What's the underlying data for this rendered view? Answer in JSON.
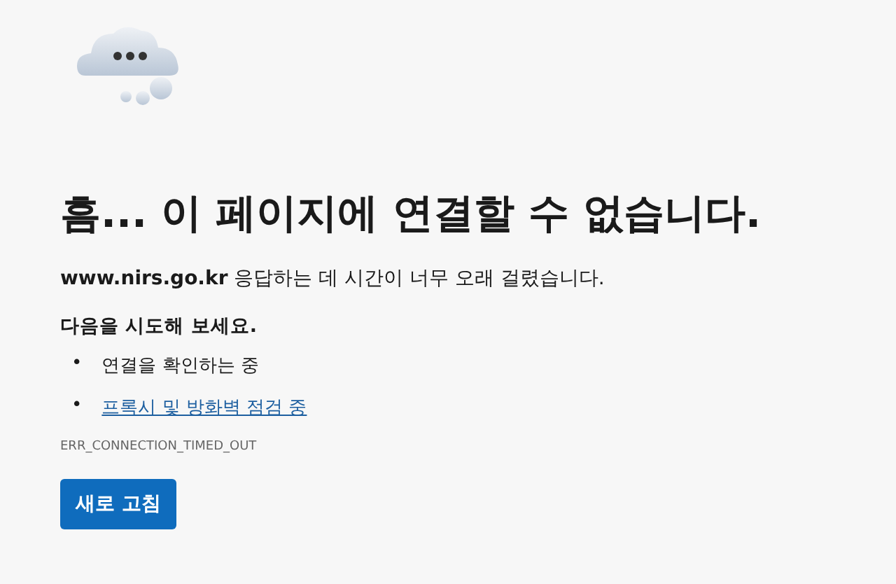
{
  "heading": "흠... 이 페이지에 연결할 수 없습니다.",
  "message": "**www.nirs.go.kr** 응답하는 데 시간이 너무 오래 걸렸습니다.",
  "suggestions_title": "다음을 시도해 보세요.",
  "suggestions": [
    {
      "kind": "text",
      "bullet": "•",
      "label": "연결을 확인하는 중"
    },
    {
      "kind": "link",
      "bullet": "•",
      "label": "프록시 및 방화벽 점검 중"
    }
  ],
  "error_code": "ERR_CONNECTION_TIMED_OUT",
  "button": "새로 고침"
}
